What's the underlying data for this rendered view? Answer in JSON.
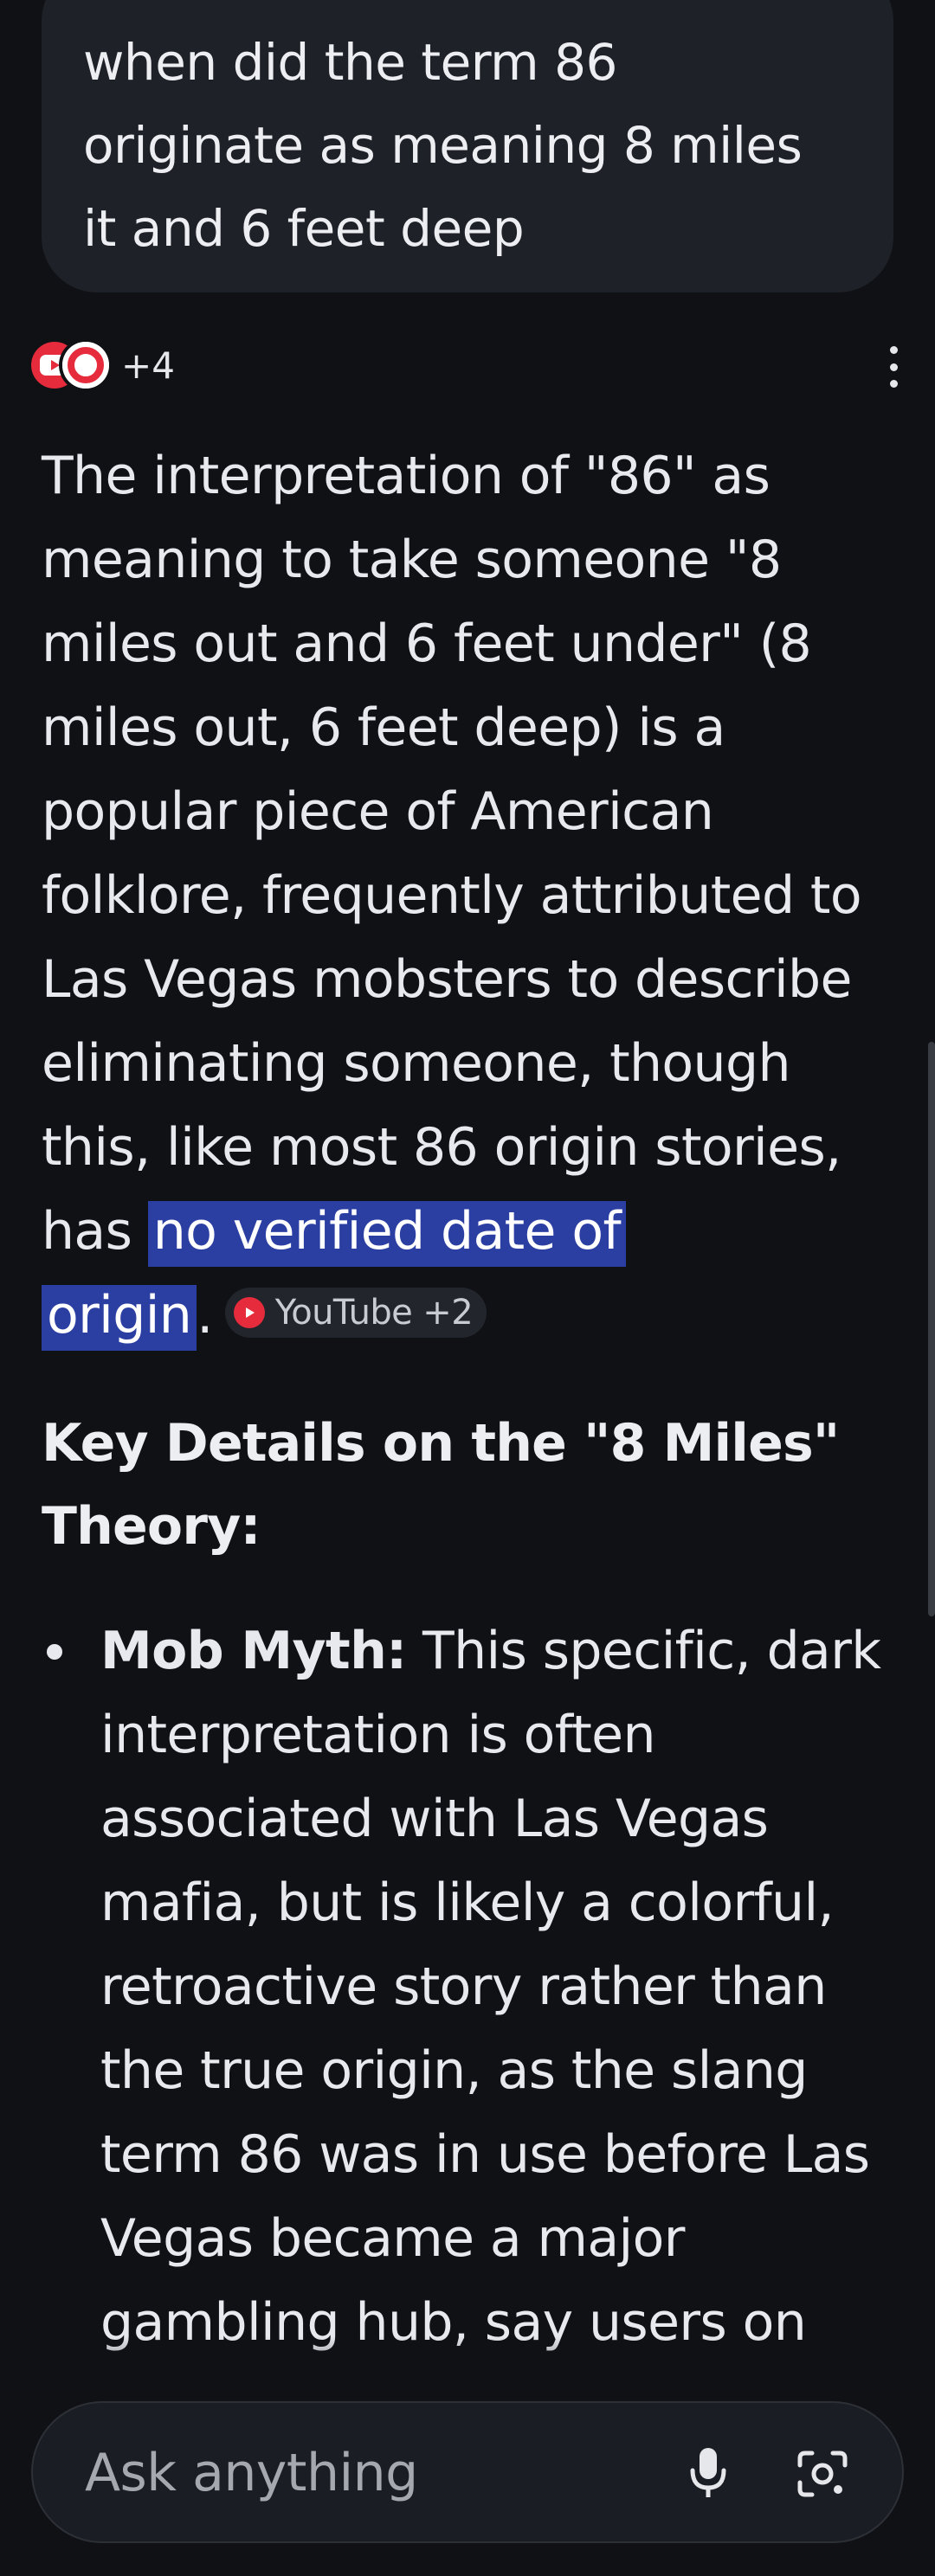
{
  "query": {
    "lines": [
      "when did the term 86",
      "originate as meaning 8 miles",
      "it and 6 feet deep"
    ]
  },
  "sources": {
    "count_label": "+4"
  },
  "answer": {
    "lines": [
      "The interpretation of \"86\" as",
      "meaning to take someone \"8",
      "miles out and 6 feet under\" (8",
      "miles out, 6 feet deep) is a",
      "popular piece of American",
      "folklore, frequently attributed to",
      "Las Vegas mobsters to describe",
      "eliminating someone, though",
      "this, like most 86 origin stories,"
    ],
    "last_prefix": "has ",
    "highlight_part1": "no verified date of",
    "highlight_part2": "origin",
    "period": ".",
    "citation_label": "YouTube +2"
  },
  "section": {
    "heading_lines": [
      "Key Details on the \"8 Miles\"",
      "Theory:"
    ],
    "bullets": [
      {
        "bold": "Mob Myth:",
        "first_line_rest": " This specific, dark",
        "lines": [
          "interpretation is often",
          "associated with Las Vegas",
          "mafia, but is likely a colorful,",
          "retroactive story rather than",
          "the true origin, as the slang",
          "term 86 was in use before Las",
          "Vegas became a major",
          "gambling hub, say users on"
        ]
      }
    ]
  },
  "input": {
    "placeholder": "Ask anything",
    "mic_icon": "microphone-icon",
    "lens_icon": "camera-lens-icon"
  },
  "colors": {
    "background": "#0f1115",
    "bubble": "#1f2128",
    "highlight": "#2b3fa3",
    "youtube_red": "#e62b3c"
  }
}
